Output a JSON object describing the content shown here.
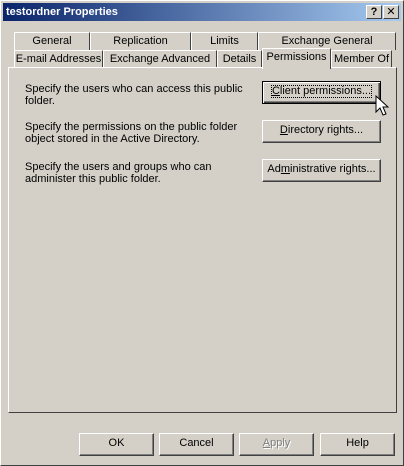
{
  "window": {
    "title": "testordner Properties"
  },
  "titlebar_buttons": {
    "help": "?",
    "close": "✕"
  },
  "tabs_row1": [
    {
      "label": "General"
    },
    {
      "label": "Replication"
    },
    {
      "label": "Limits"
    },
    {
      "label": "Exchange General"
    }
  ],
  "tabs_row2": [
    {
      "label": "E-mail Addresses"
    },
    {
      "label": "Exchange Advanced"
    },
    {
      "label": "Details"
    },
    {
      "label": "Permissions",
      "active": true
    },
    {
      "label": "Member Of"
    }
  ],
  "permissions": {
    "client_desc": "Specify the users who can access this public folder.",
    "client_btn": {
      "pre": "",
      "u": "C",
      "post": "lient permissions..."
    },
    "directory_desc": "Specify the permissions on the public folder object stored in the Active Directory.",
    "directory_btn": {
      "pre": "",
      "u": "D",
      "post": "irectory rights..."
    },
    "admin_desc": "Specify the users and groups who can administer this public folder.",
    "admin_btn": {
      "pre": "Ad",
      "u": "m",
      "post": "inistrative rights..."
    }
  },
  "footer": {
    "ok": "OK",
    "cancel": "Cancel",
    "apply": {
      "u": "A",
      "post": "pply"
    },
    "help": "Help"
  }
}
